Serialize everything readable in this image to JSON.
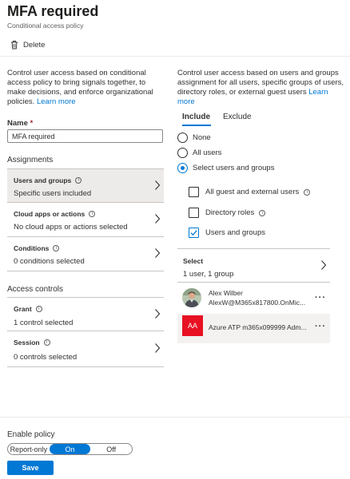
{
  "header": {
    "title": "MFA required",
    "subtitle": "Conditional access policy"
  },
  "toolbar": {
    "delete_label": "Delete"
  },
  "left": {
    "description": "Control user access based on conditional access policy to bring signals together, to make decisions, and enforce organizational policies.",
    "learn_more": "Learn more",
    "name_label": "Name",
    "name_required": "*",
    "name_value": "MFA required",
    "assignments_label": "Assignments",
    "access_controls_label": "Access controls",
    "assignments": [
      {
        "title": "Users and groups",
        "value": "Specific users included"
      },
      {
        "title": "Cloud apps or actions",
        "value": "No cloud apps or actions selected"
      },
      {
        "title": "Conditions",
        "value": "0 conditions selected"
      }
    ],
    "access_controls": [
      {
        "title": "Grant",
        "value": "1 control selected"
      },
      {
        "title": "Session",
        "value": "0 controls selected"
      }
    ]
  },
  "right": {
    "description": "Control user access based on users and groups assignment for all users, specific groups of users, directory roles, or external guest users",
    "learn_more": "Learn more",
    "tabs": [
      "Include",
      "Exclude"
    ],
    "radios": [
      {
        "label": "None",
        "selected": false
      },
      {
        "label": "All users",
        "selected": false
      },
      {
        "label": "Select users and groups",
        "selected": true
      }
    ],
    "checkboxes": [
      {
        "label": "All guest and external users",
        "checked": false,
        "info": true
      },
      {
        "label": "Directory roles",
        "checked": false,
        "info": true
      },
      {
        "label": "Users and groups",
        "checked": true,
        "info": false
      }
    ],
    "select": {
      "title": "Select",
      "value": "1 user, 1 group"
    },
    "members": [
      {
        "name": "Alex Wilber",
        "email": "AlexW@M365x817800.OnMic...",
        "avatar": "photo"
      },
      {
        "name": "Azure ATP m365x099999 Adm...",
        "email": "",
        "avatar": "AA"
      }
    ],
    "more_glyph": "···"
  },
  "footer": {
    "enable_label": "Enable policy",
    "toggle_options": [
      "Report-only",
      "On",
      "Off"
    ],
    "toggle_selected": "On",
    "save_label": "Save"
  },
  "colors": {
    "accent": "#0078d4",
    "required": "#a4262c",
    "group_avatar": "#e81123"
  }
}
